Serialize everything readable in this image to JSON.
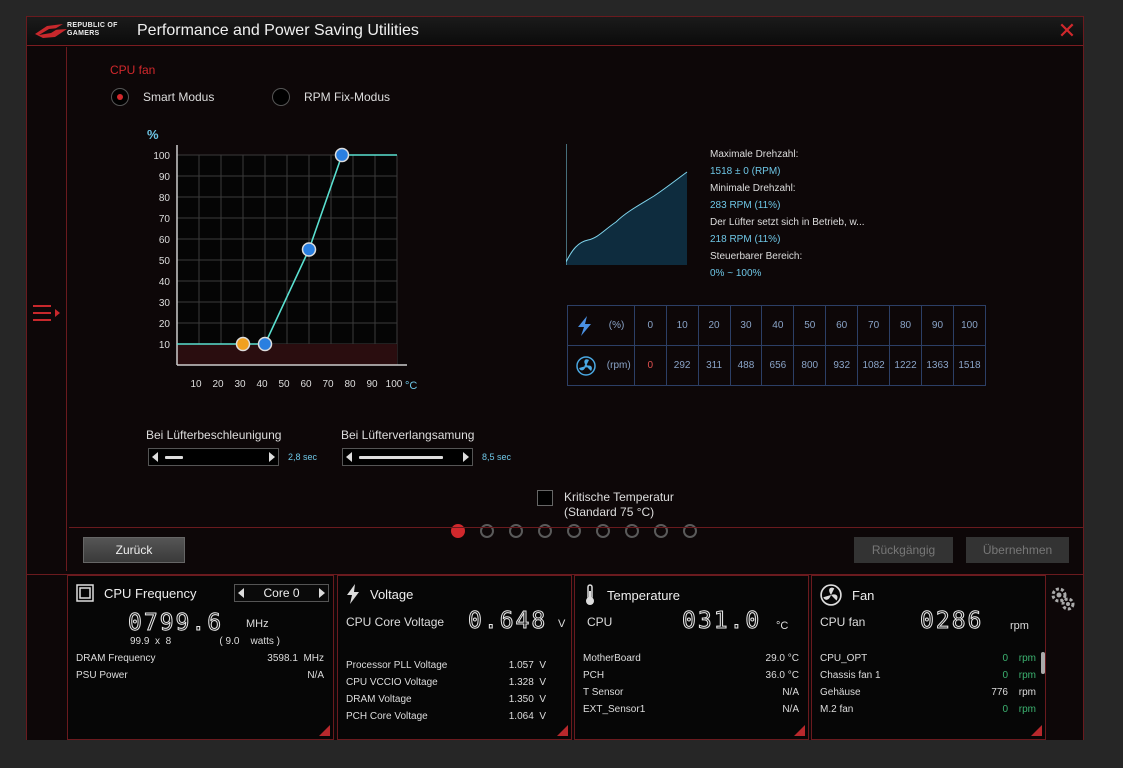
{
  "window": {
    "brand_line1": "REPUBLIC OF",
    "brand_line2": "GAMERS",
    "title": "Performance and Power Saving Utilities",
    "close": "✕"
  },
  "fan": {
    "section_label": "CPU fan",
    "mode_smart": "Smart Modus",
    "mode_rpm": "RPM Fix-Modus",
    "selected_mode": "Smart Modus",
    "graph": {
      "y_unit": "%",
      "x_unit": "°C",
      "y_ticks": [
        "10",
        "20",
        "30",
        "40",
        "50",
        "60",
        "70",
        "80",
        "90",
        "100"
      ],
      "x_ticks": [
        "10",
        "20",
        "30",
        "40",
        "50",
        "60",
        "70",
        "80",
        "90",
        "100"
      ],
      "curve_points": [
        {
          "t": 30,
          "p": 10,
          "color": "orange"
        },
        {
          "t": 40,
          "p": 10,
          "color": "blue"
        },
        {
          "t": 60,
          "p": 55,
          "color": "blue"
        },
        {
          "t": 75,
          "p": 100,
          "color": "blue"
        }
      ],
      "zone_colors": [
        "#1f5fbf",
        "#1f5fbf",
        "#1f5fbf",
        "#1f5fbf",
        "#1f9a3f",
        "#1f9a3f",
        "#e0a010",
        "#e0a010",
        "#c02020",
        "#c02020"
      ]
    },
    "info": {
      "max_label": "Maximale Drehzahl:",
      "max_value": "1518 ± 0 (RPM)",
      "min_label": "Minimale Drehzahl:",
      "min_value": "283 RPM (11%)",
      "start_label": "Der Lüfter setzt sich in Betrieb, w...",
      "start_value": "218 RPM (11%)",
      "range_label": "Steuerbarer Bereich:",
      "range_value": "0% ~ 100%"
    },
    "table": {
      "pct_unit": "(%)",
      "rpm_unit": "(rpm)",
      "percents": [
        "0",
        "10",
        "20",
        "30",
        "40",
        "50",
        "60",
        "70",
        "80",
        "90",
        "100"
      ],
      "rpms": [
        "0",
        "292",
        "311",
        "488",
        "656",
        "800",
        "932",
        "1082",
        "1222",
        "1363",
        "1518"
      ]
    },
    "accel_label": "Bei Lüfterbeschleunigung",
    "accel_value": "2,8 sec",
    "accel_level": 0.18,
    "decel_label": "Bei Lüfterverlangsamung",
    "decel_value": "8,5 sec",
    "decel_level": 0.85,
    "critical_line1": "Kritische Temperatur",
    "critical_line2": "(Standard 75 °C)",
    "page_count": 9,
    "active_page": 0,
    "back": "Zurück",
    "undo": "Rückgängig",
    "apply": "Übernehmen"
  },
  "bottom": {
    "cpu": {
      "title": "CPU Frequency",
      "core": "Core 0",
      "freq": "0799.6",
      "unit": "MHz",
      "mult": "99.9  x  8",
      "watts": "( 9.0    watts )",
      "rows": [
        {
          "label": "DRAM Frequency",
          "value": "3598.1  MHz"
        },
        {
          "label": "PSU Power",
          "value": "N/A"
        }
      ]
    },
    "voltage": {
      "title": "Voltage",
      "main_label": "CPU Core Voltage",
      "main_value": "0.648",
      "unit": "V",
      "rows": [
        {
          "label": "Processor PLL Voltage",
          "value": "1.057  V"
        },
        {
          "label": "CPU VCCIO Voltage",
          "value": "1.328  V"
        },
        {
          "label": "DRAM Voltage",
          "value": "1.350  V"
        },
        {
          "label": "PCH Core Voltage",
          "value": "1.064  V"
        }
      ]
    },
    "temperature": {
      "title": "Temperature",
      "main_label": "CPU",
      "main_value": "031.0",
      "unit": "°C",
      "rows": [
        {
          "label": "MotherBoard",
          "value": "29.0 °C"
        },
        {
          "label": "PCH",
          "value": "36.0 °C"
        },
        {
          "label": "T Sensor",
          "value": "N/A"
        },
        {
          "label": "EXT_Sensor1",
          "value": "N/A"
        }
      ]
    },
    "fan": {
      "title": "Fan",
      "main_label": "CPU fan",
      "main_value": "0286",
      "unit": "rpm",
      "rows": [
        {
          "label": "CPU_OPT",
          "value": "0",
          "unit": "rpm"
        },
        {
          "label": "Chassis fan 1",
          "value": "0",
          "unit": "rpm"
        },
        {
          "label": "Gehäuse",
          "value": "776",
          "unit": "rpm"
        },
        {
          "label": "M.2 fan",
          "value": "0",
          "unit": "rpm"
        }
      ]
    }
  }
}
